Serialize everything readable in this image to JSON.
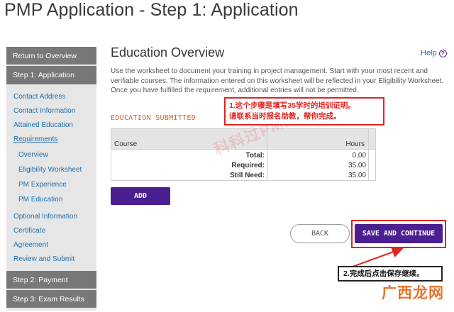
{
  "page": {
    "title": "PMP Application - Step 1: Application"
  },
  "sidebar": {
    "return_label": "Return to Overview",
    "step1_label": "Step 1: Application",
    "links": [
      "Contact Address",
      "Contact Information",
      "Attained Education",
      "Requirements",
      "Overview",
      "Eligibility Worksheet",
      "PM Experience",
      "PM Education",
      "Optional Information",
      "Certificate",
      "Agreement",
      "Review and Submit"
    ],
    "step2_label": "Step 2: Payment",
    "step3_label": "Step 3: Exam Results"
  },
  "main": {
    "heading": "Education Overview",
    "help_label": "Help",
    "help_icon": "question-circle-icon",
    "intro": "Use the worksheet to document your training in project management. Start with your most recent and verifiable courses. The information entered on this worksheet will be reflected in your Eligibility Worksheet. Once you have fulfilled the requirement, additional entries will not be permitted.",
    "section_label": "EDUCATION SUBMITTED",
    "table": {
      "col_course": "Course",
      "col_hours": "Hours",
      "rows": [
        {
          "label": "Total:",
          "value": "0.00"
        },
        {
          "label": "Required:",
          "value": "35.00"
        },
        {
          "label": "Still Need:",
          "value": "35.00"
        }
      ]
    },
    "add_label": "ADD",
    "back_label": "BACK",
    "save_label": "SAVE AND CONTINUE"
  },
  "annotations": {
    "note1_line1": "1.这个步骤是填写35学时的培训证明。",
    "note1_line2": "请联系当时报名助教，帮你完成。",
    "note2": "2.完成后点击保存继续。",
    "watermark": "科科过PMP®",
    "brand": "广西龙网"
  },
  "colors": {
    "accent_purple": "#4b1f8f",
    "annotation_red": "#e02424",
    "link_blue": "#1f6fae",
    "section_orange": "#d9622b"
  }
}
